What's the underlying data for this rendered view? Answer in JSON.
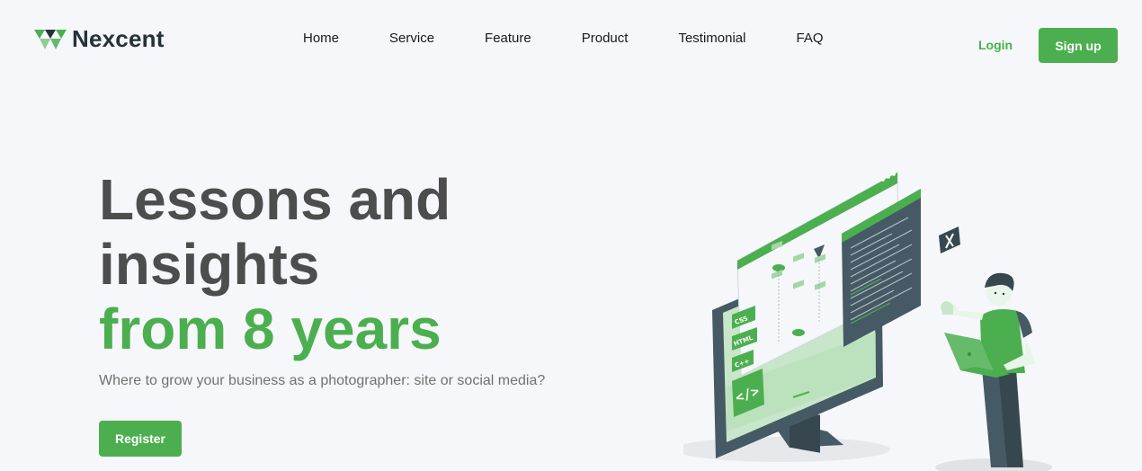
{
  "brand": {
    "name": "Nexcent",
    "logo_icon": "triangle-logo-icon",
    "accent": "#4CAF4F"
  },
  "nav": {
    "items": [
      {
        "label": "Home"
      },
      {
        "label": "Service"
      },
      {
        "label": "Feature"
      },
      {
        "label": "Product"
      },
      {
        "label": "Testimonial"
      },
      {
        "label": "FAQ"
      }
    ]
  },
  "auth": {
    "login_label": "Login",
    "signup_label": "Sign up"
  },
  "hero": {
    "title_line1": "Lessons and",
    "title_line2": "insights",
    "title_highlight": "from 8 years",
    "subtitle": "Where to grow your business as a photographer: site or social media?",
    "cta_label": "Register"
  },
  "illustration": {
    "code_tags": [
      "CSS",
      "HTML",
      "C++"
    ],
    "code_symbol": "</>"
  }
}
